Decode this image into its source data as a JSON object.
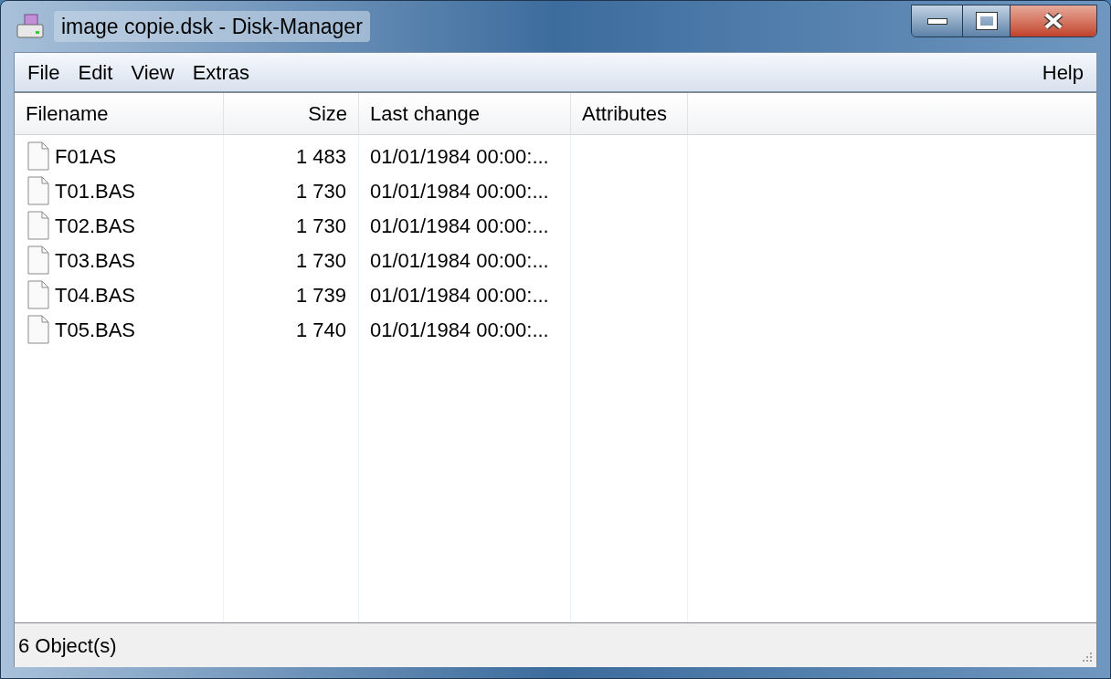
{
  "window": {
    "title": "image copie.dsk - Disk-Manager"
  },
  "menu": {
    "left": [
      "File",
      "Edit",
      "View",
      "Extras"
    ],
    "right": [
      "Help"
    ]
  },
  "table": {
    "columns": [
      "Filename",
      "Size",
      "Last change",
      "Attributes"
    ],
    "rows": [
      {
        "name": "F01AS",
        "size": "1 483",
        "changed": "01/01/1984 00:00:..."
      },
      {
        "name": "T01.BAS",
        "size": "1 730",
        "changed": "01/01/1984 00:00:..."
      },
      {
        "name": "T02.BAS",
        "size": "1 730",
        "changed": "01/01/1984 00:00:..."
      },
      {
        "name": "T03.BAS",
        "size": "1 730",
        "changed": "01/01/1984 00:00:..."
      },
      {
        "name": "T04.BAS",
        "size": "1 739",
        "changed": "01/01/1984 00:00:..."
      },
      {
        "name": "T05.BAS",
        "size": "1 740",
        "changed": "01/01/1984 00:00:..."
      }
    ]
  },
  "status_bar": "6 Object(s)"
}
